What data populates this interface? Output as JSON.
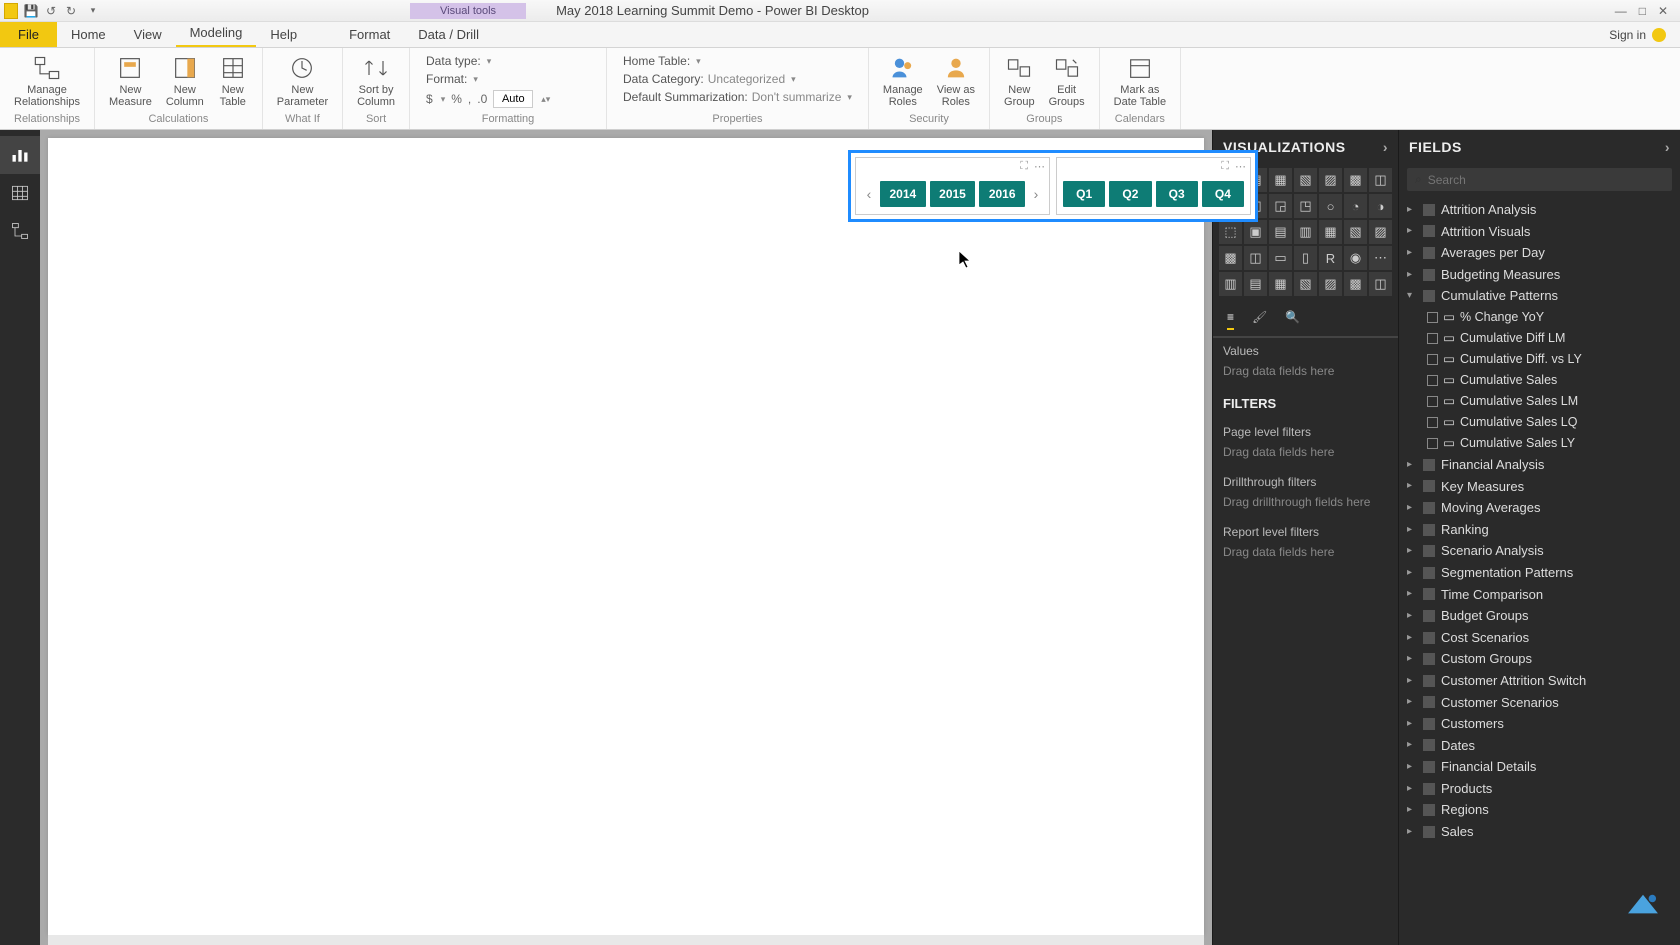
{
  "title": "May 2018 Learning Summit Demo - Power BI Desktop",
  "contextual_tab": "Visual tools",
  "qat": {
    "save": "💾",
    "undo": "↺",
    "redo": "↻"
  },
  "win": {
    "min": "—",
    "max": "□",
    "close": "✕"
  },
  "signin": "Sign in",
  "tabs": {
    "file": "File",
    "home": "Home",
    "view": "View",
    "modeling": "Modeling",
    "help": "Help",
    "format": "Format",
    "datadrill": "Data / Drill"
  },
  "ribbon": {
    "relationships": {
      "label": "Relationships",
      "manage": "Manage\nRelationships"
    },
    "calculations": {
      "label": "Calculations",
      "new_measure": "New\nMeasure",
      "new_column": "New\nColumn",
      "new_table": "New\nTable"
    },
    "whatif": {
      "label": "What If",
      "new_param": "New\nParameter"
    },
    "sort": {
      "label": "Sort",
      "sortby": "Sort by\nColumn"
    },
    "formatting": {
      "label": "Formatting",
      "datatype_k": "Data type:",
      "format_k": "Format:",
      "currency": "$",
      "percent": "%",
      "comma": ",",
      "decimals": ".0",
      "auto": "Auto"
    },
    "properties": {
      "label": "Properties",
      "home_table_k": "Home Table:",
      "data_cat_k": "Data Category:",
      "data_cat_v": "Uncategorized",
      "summarize_k": "Default Summarization:",
      "summarize_v": "Don't summarize"
    },
    "security": {
      "label": "Security",
      "manage_roles": "Manage\nRoles",
      "view_as": "View as\nRoles"
    },
    "groups": {
      "label": "Groups",
      "new_group": "New\nGroup",
      "edit_groups": "Edit\nGroups"
    },
    "calendars": {
      "label": "Calendars",
      "mark_date": "Mark as\nDate Table"
    }
  },
  "slicers": {
    "years": [
      "2014",
      "2015",
      "2016"
    ],
    "quarters": [
      "Q1",
      "Q2",
      "Q3",
      "Q4"
    ]
  },
  "viz_panel": {
    "title": "VISUALIZATIONS",
    "values_label": "Values",
    "values_hint": "Drag data fields here",
    "filters_title": "FILTERS",
    "page_filters": "Page level filters",
    "page_hint": "Drag data fields here",
    "drill_label": "Drillthrough filters",
    "drill_hint": "Drag drillthrough fields here",
    "report_filters": "Report level filters",
    "report_hint": "Drag data fields here"
  },
  "fields_panel": {
    "title": "FIELDS",
    "search_placeholder": "Search",
    "tables": [
      "Attrition Analysis",
      "Attrition Visuals",
      "Averages per Day",
      "Budgeting Measures"
    ],
    "expanded_table": "Cumulative Patterns",
    "measures": [
      "% Change YoY",
      "Cumulative Diff LM",
      "Cumulative Diff. vs LY",
      "Cumulative Sales",
      "Cumulative Sales LM",
      "Cumulative Sales LQ",
      "Cumulative Sales LY"
    ],
    "tables_after": [
      "Financial Analysis",
      "Key Measures",
      "Moving Averages",
      "Ranking",
      "Scenario Analysis",
      "Segmentation Patterns",
      "Time Comparison",
      "Budget Groups",
      "Cost Scenarios",
      "Custom Groups",
      "Customer Attrition Switch",
      "Customer Scenarios",
      "Customers",
      "Dates",
      "Financial Details",
      "Products",
      "Regions",
      "Sales"
    ]
  }
}
